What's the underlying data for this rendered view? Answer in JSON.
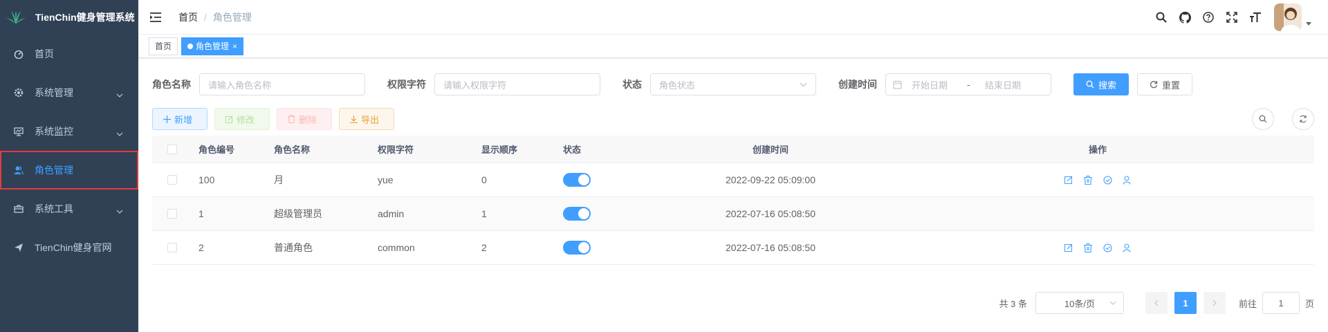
{
  "app": {
    "title": "TienChin健身管理系统"
  },
  "sidebar": {
    "items": [
      {
        "label": "首页",
        "icon": "dashboard-icon",
        "has_children": false,
        "active": false
      },
      {
        "label": "系统管理",
        "icon": "gear-icon",
        "has_children": true,
        "active": false
      },
      {
        "label": "系统监控",
        "icon": "monitor-icon",
        "has_children": true,
        "active": false
      },
      {
        "label": "角色管理",
        "icon": "user-icon",
        "has_children": false,
        "active": true
      },
      {
        "label": "系统工具",
        "icon": "toolbox-icon",
        "has_children": true,
        "active": false
      },
      {
        "label": "TienChin健身官网",
        "icon": "send-icon",
        "has_children": false,
        "active": false
      }
    ]
  },
  "header": {
    "breadcrumb": {
      "home": "首页",
      "separator": "/",
      "current": "角色管理"
    }
  },
  "tags": [
    {
      "label": "首页",
      "active": false
    },
    {
      "label": "角色管理",
      "active": true,
      "close": "×"
    }
  ],
  "search": {
    "role_name_label": "角色名称",
    "role_name_placeholder": "请输入角色名称",
    "role_key_label": "权限字符",
    "role_key_placeholder": "请输入权限字符",
    "status_label": "状态",
    "status_placeholder": "角色状态",
    "created_label": "创建时间",
    "start_placeholder": "开始日期",
    "range_sep": "-",
    "end_placeholder": "结束日期",
    "search_button": "搜索",
    "reset_button": "重置"
  },
  "toolbar": {
    "add": "新增",
    "edit": "修改",
    "delete": "删除",
    "export": "导出"
  },
  "table": {
    "columns": [
      "角色编号",
      "角色名称",
      "权限字符",
      "显示顺序",
      "状态",
      "创建时间",
      "操作"
    ],
    "rows": [
      {
        "id": "100",
        "name": "月",
        "key": "yue",
        "sort": "0",
        "status_on": true,
        "created": "2022-09-22 05:09:00",
        "ops": true
      },
      {
        "id": "1",
        "name": "超级管理员",
        "key": "admin",
        "sort": "1",
        "status_on": true,
        "created": "2022-07-16 05:08:50",
        "ops": false
      },
      {
        "id": "2",
        "name": "普通角色",
        "key": "common",
        "sort": "2",
        "status_on": true,
        "created": "2022-07-16 05:08:50",
        "ops": true
      }
    ]
  },
  "pagination": {
    "total": "共 3 条",
    "page_size": "10条/页",
    "current_page": "1",
    "goto_label": "前往",
    "goto_value": "1",
    "page_suffix": "页"
  },
  "colors": {
    "sidebar_bg": "#304156",
    "primary": "#409eff",
    "highlight_outline": "#e23b3b"
  }
}
